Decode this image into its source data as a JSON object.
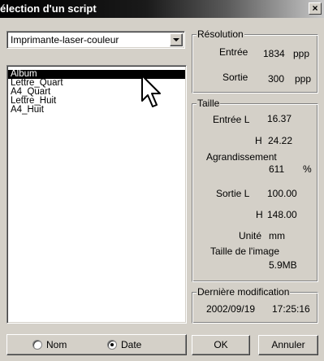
{
  "window": {
    "title": "élection d'un script",
    "close_glyph": "×"
  },
  "printer_select": {
    "value": "Imprimante-laser-couleur"
  },
  "scripts": {
    "items": [
      "Album",
      "Lettre_Quart",
      "A4_Quart",
      "Lettre_Huit",
      "A4_Huit"
    ],
    "selected_index": 0
  },
  "resolution": {
    "legend": "Résolution",
    "input_label": "Entrée",
    "input_value": "1834",
    "input_unit": "ppp",
    "output_label": "Sortie",
    "output_value": "300",
    "output_unit": "ppp"
  },
  "size": {
    "legend": "Taille",
    "input_l_label": "Entrée L",
    "input_l_value": "16.37",
    "input_h_label": "H",
    "input_h_value": "24.22",
    "enlargement_label": "Agrandissement",
    "enlargement_value": "611",
    "enlargement_unit": "%",
    "output_l_label": "Sortie L",
    "output_l_value": "100.00",
    "output_h_label": "H",
    "output_h_value": "148.00",
    "unit_label": "Unité",
    "unit_value": "mm",
    "image_size_label": "Taille de l'image",
    "image_size_value": "5.9MB"
  },
  "last_modified": {
    "legend": "Dernière modification",
    "date": "2002/09/19",
    "time": "17:25:16"
  },
  "sort": {
    "name_label": "Nom",
    "date_label": "Date",
    "selected": "date"
  },
  "buttons": {
    "ok": "OK",
    "cancel": "Annuler"
  },
  "icons": {
    "close": "close-icon",
    "cursor": "mouse-pointer-icon",
    "dropdown": "chevron-down-icon"
  }
}
